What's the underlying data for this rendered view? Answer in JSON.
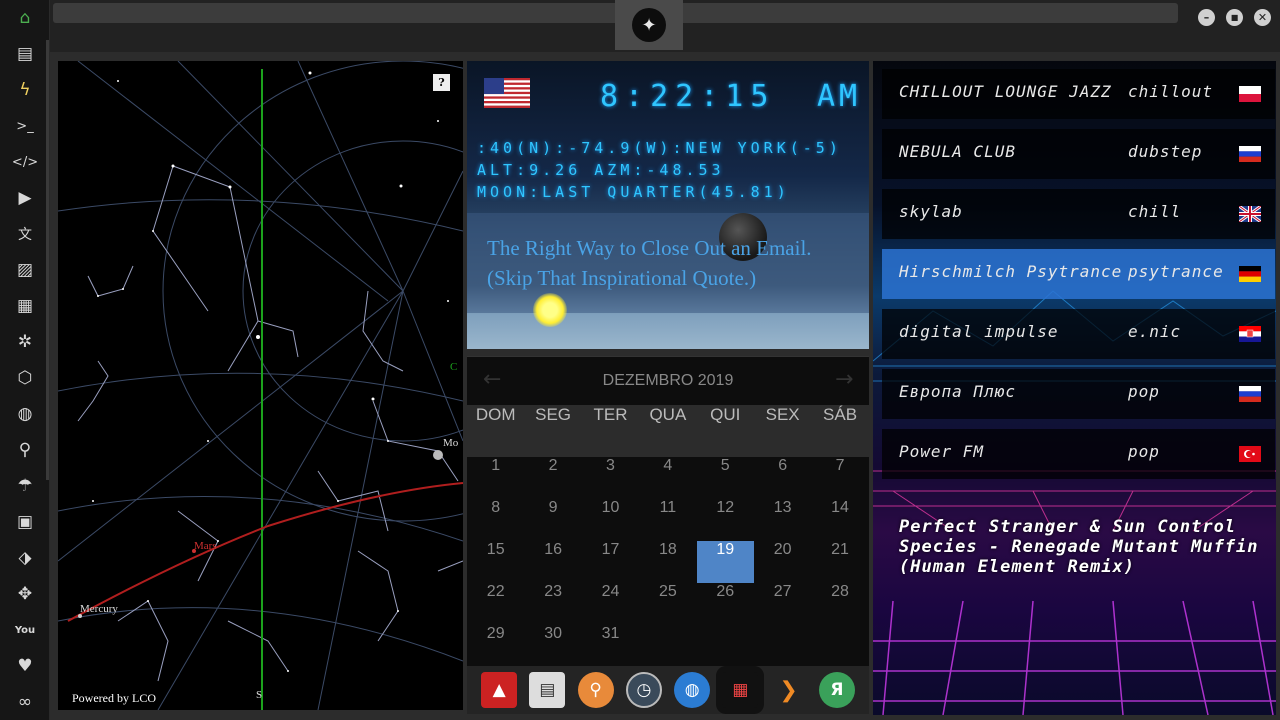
{
  "topbar": {
    "minimize": "–",
    "maximize": "■",
    "close": "✕"
  },
  "sidebar": {
    "items": [
      "home-icon",
      "document-icon",
      "lightning-icon",
      "terminal-icon",
      "code-icon",
      "play-icon",
      "translate-icon",
      "image-icon",
      "news-icon",
      "asterisk-icon",
      "hexagon-icon",
      "globe-icon",
      "search-icon",
      "umbrella-icon",
      "contact-icon",
      "link-icon",
      "fullscreen-icon",
      "youtube-icon",
      "heart-icon",
      "infinity-icon"
    ]
  },
  "skymap": {
    "help": "?",
    "powered_by": "Powered by LCO",
    "labels": {
      "mars": "Mars",
      "mercury": "Mercury",
      "moon": "Mo",
      "south": "S",
      "c": "C"
    }
  },
  "clock": {
    "time": "8:22:15",
    "ampm": "AM",
    "location": ":40(N):-74.9(W):NEW YORK(-5)",
    "altaz": "ALT:9.26 AZM:-48.53",
    "moon": "MOON:LAST QUARTER(45.81)",
    "quote": "The Right Way to Close Out an Email. (Skip That Inspirational Quote.)"
  },
  "calendar": {
    "month": "DEZEMBRO 2019",
    "prev": "←",
    "next": "→",
    "weekdays": [
      "DOM",
      "SEG",
      "TER",
      "QUA",
      "QUI",
      "SEX",
      "SÁB"
    ],
    "weeks": [
      [
        "1",
        "2",
        "3",
        "4",
        "5",
        "6",
        "7"
      ],
      [
        "8",
        "9",
        "10",
        "11",
        "12",
        "13",
        "14"
      ],
      [
        "15",
        "16",
        "17",
        "18",
        "19",
        "20",
        "21"
      ],
      [
        "22",
        "23",
        "24",
        "25",
        "26",
        "27",
        "28"
      ],
      [
        "29",
        "30",
        "31",
        "",
        "",
        "",
        ""
      ]
    ],
    "today": "19"
  },
  "dock": [
    "adobe-icon",
    "news-app-icon",
    "search-app-icon",
    "clock-app-icon",
    "globe-app-icon",
    "calendar-app-icon",
    "play-app-icon",
    "yandex-icon"
  ],
  "radio": {
    "stations": [
      {
        "name": "CHILLOUT LOUNGE JAZZ",
        "genre": "chillout",
        "flag": "pl"
      },
      {
        "name": "NEBULA CLUB",
        "genre": "dubstep",
        "flag": "ru"
      },
      {
        "name": "skylab",
        "genre": "chill",
        "flag": "gb"
      },
      {
        "name": "Hirschmilch Psytrance",
        "genre": "psytrance",
        "flag": "de"
      },
      {
        "name": "digital impulse",
        "genre": "e.nic",
        "flag": "hr"
      },
      {
        "name": "Европа Плюс",
        "genre": "pop",
        "flag": "ru"
      },
      {
        "name": "Power FM",
        "genre": "pop",
        "flag": "tr"
      }
    ],
    "active_index": 3,
    "now_playing": "Perfect Stranger & Sun Control Species - Renegade Mutant Muffin (Human Element Remix)"
  },
  "colors": {
    "accent_blue": "#4f85c7",
    "digit_cyan": "#2fc6ff",
    "active_station": "#2b73d2",
    "home_green": "#4caf50"
  }
}
